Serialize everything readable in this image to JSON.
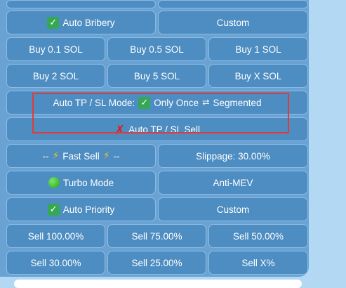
{
  "rows": {
    "auto_bribery": "Auto Bribery",
    "bribery_custom": "Custom",
    "buy_0_1": "Buy 0.1 SOL",
    "buy_0_5": "Buy 0.5 SOL",
    "buy_1": "Buy 1 SOL",
    "buy_2": "Buy 2 SOL",
    "buy_5": "Buy 5 SOL",
    "buy_x": "Buy X SOL",
    "tp_sl_mode_label": "Auto TP / SL Mode:",
    "tp_sl_mode_only_once": "Only Once",
    "tp_sl_mode_arrows": "⮂",
    "tp_sl_mode_segmented": "Segmented",
    "auto_tp_sl_sell": "Auto TP / SL Sell",
    "fast_sell_prefix": "--",
    "fast_sell": "Fast Sell",
    "fast_sell_suffix": "--",
    "slippage": "Slippage: 30.00%",
    "turbo_mode": "Turbo Mode",
    "anti_mev": "Anti-MEV",
    "auto_priority": "Auto Priority",
    "priority_custom": "Custom",
    "sell_100": "Sell 100.00%",
    "sell_75": "Sell 75.00%",
    "sell_50": "Sell 50.00%",
    "sell_30": "Sell 30.00%",
    "sell_25": "Sell 25.00%",
    "sell_x": "Sell X%"
  },
  "icons": {
    "check": "✓",
    "cross": "✗",
    "bolt": "⚡"
  },
  "colors": {
    "panel_bg": "#6aa3d3",
    "button_bg": "#4d8dc2",
    "highlight_border": "#e53935",
    "check_green": "#34a853",
    "cross_red": "#e21b1b"
  }
}
